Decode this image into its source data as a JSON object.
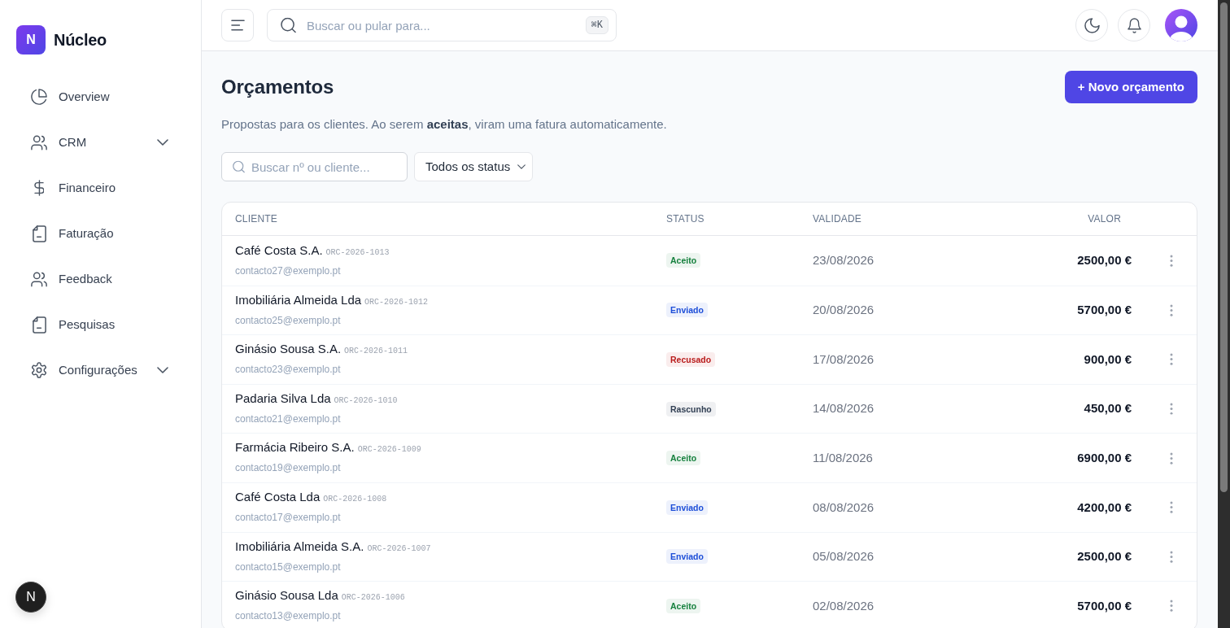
{
  "sidebar": {
    "logo": {
      "mark": "N",
      "name": "Núcleo"
    },
    "items": [
      {
        "label": "Overview",
        "kind": "link",
        "selected": false
      },
      {
        "label": "CRM",
        "kind": "group",
        "selected": false,
        "expanded": false
      },
      {
        "label": "Financeiro",
        "kind": "link",
        "selected": false
      },
      {
        "label": "Faturação",
        "kind": "link",
        "selected": false
      },
      {
        "label": "Feedback",
        "kind": "link",
        "selected": false
      },
      {
        "label": "Pesquisas",
        "kind": "link",
        "selected": false
      },
      {
        "label": "Configurações",
        "kind": "group",
        "selected": false,
        "expanded": false
      }
    ]
  },
  "topbar": {
    "search": {
      "placeholder": "Buscar ou pular para...",
      "shortcut": "⌘K"
    }
  },
  "page": {
    "title": "Orçamentos",
    "new_button": "+ Novo orçamento",
    "description": "Propostas para os clientes. Ao serem **aceitas**, viram uma fatura automaticamente.",
    "filters": {
      "search": {
        "placeholder": "Buscar nº ou cliente..."
      },
      "status": {
        "value": "Todos os status"
      }
    }
  },
  "table": {
    "columns": [
      "CLIENTE",
      "STATUS",
      "VALIDADE",
      "VALOR"
    ],
    "rows": [
      {
        "client": "Café Costa S.A.",
        "number": "ORC-2026-1013",
        "email": "contacto27@exemplo.pt",
        "status": {
          "label": "Aceito",
          "color": "#15803d"
        },
        "validity": "23/08/2026",
        "value": "2500,00 €"
      },
      {
        "client": "Imobiliária Almeida Lda",
        "number": "ORC-2026-1012",
        "email": "contacto25@exemplo.pt",
        "status": {
          "label": "Enviado",
          "color": "#1d4ed8"
        },
        "validity": "20/08/2026",
        "value": "5700,00 €"
      },
      {
        "client": "Ginásio Sousa S.A.",
        "number": "ORC-2026-1011",
        "email": "contacto23@exemplo.pt",
        "status": {
          "label": "Recusado",
          "color": "#b91c1c"
        },
        "validity": "17/08/2026",
        "value": "900,00 €"
      },
      {
        "client": "Padaria Silva Lda",
        "number": "ORC-2026-1010",
        "email": "contacto21@exemplo.pt",
        "status": {
          "label": "Rascunho",
          "color": "#334155"
        },
        "validity": "14/08/2026",
        "value": "450,00 €"
      },
      {
        "client": "Farmácia Ribeiro S.A.",
        "number": "ORC-2026-1009",
        "email": "contacto19@exemplo.pt",
        "status": {
          "label": "Aceito",
          "color": "#15803d"
        },
        "validity": "11/08/2026",
        "value": "6900,00 €"
      },
      {
        "client": "Café Costa Lda",
        "number": "ORC-2026-1008",
        "email": "contacto17@exemplo.pt",
        "status": {
          "label": "Enviado",
          "color": "#1d4ed8"
        },
        "validity": "08/08/2026",
        "value": "4200,00 €"
      },
      {
        "client": "Imobiliária Almeida S.A.",
        "number": "ORC-2026-1007",
        "email": "contacto15@exemplo.pt",
        "status": {
          "label": "Enviado",
          "color": "#1d4ed8"
        },
        "validity": "05/08/2026",
        "value": "2500,00 €"
      },
      {
        "client": "Ginásio Sousa Lda",
        "number": "ORC-2026-1006",
        "email": "contacto13@exemplo.pt",
        "status": {
          "label": "Aceito",
          "color": "#15803d"
        },
        "validity": "02/08/2026",
        "value": "5700,00 €"
      }
    ]
  },
  "dev_indicator": {
    "label": "N"
  }
}
